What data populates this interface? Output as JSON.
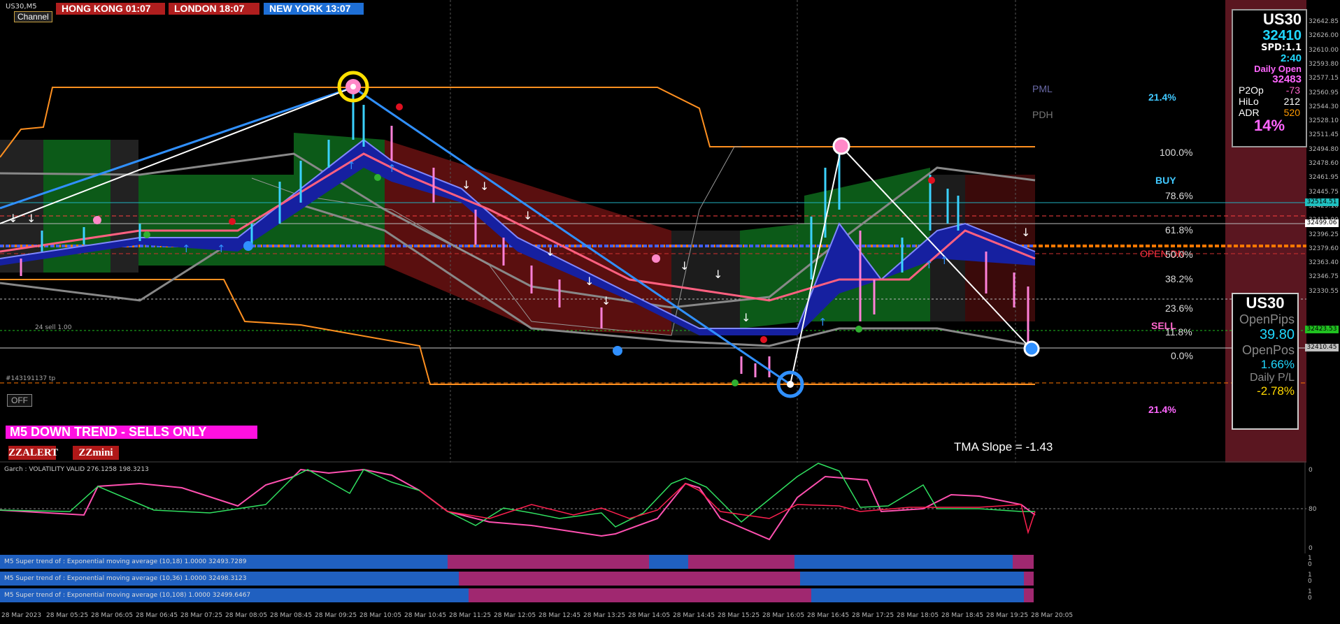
{
  "symbol": "US30,M5",
  "channel_button": "Channel",
  "sessions": [
    {
      "label": "HONG KONG 01:07",
      "color": "#b01e1e"
    },
    {
      "label": "LONDON  18:07",
      "color": "#b01e1e"
    },
    {
      "label": "NEW YORK  13:07",
      "color": "#1e6fd6"
    }
  ],
  "labels": {
    "pml": "PML",
    "pdh": "PDH",
    "buy": "BUY",
    "sell": "SELL",
    "open_dn": "OPEN  DN",
    "pct_top": "21.4%",
    "pct_bottom": "21.4%",
    "trade_label": "24 sell 1.00",
    "ticket": "#143191137 tp",
    "off_button": "OFF",
    "trend_banner": "M5  DOWN TREND - SELLS ONLY",
    "zzalert": "ZZALERT",
    "zzmini": "ZZmini",
    "tma_slope": "TMA Slope = -1.43"
  },
  "fib_levels": [
    "100.0%",
    "78.6%",
    "61.8%",
    "50.0%",
    "38.2%",
    "23.6%",
    "11.8%",
    "0.0%"
  ],
  "info_panel": {
    "symbol": "US30",
    "price": "32410",
    "spread": "SPD:1.1",
    "timer": "2:40",
    "daily_open_label": "Daily Open",
    "daily_open": "32483",
    "rows": [
      {
        "label": "P2Op",
        "value": "-73",
        "color": "#ff66cc"
      },
      {
        "label": "HiLo",
        "value": "212",
        "color": "#ffffff"
      },
      {
        "label": "ADR",
        "value": "520",
        "color": "#ff9900"
      }
    ],
    "adr_pct": "14%"
  },
  "pos_panel": {
    "symbol": "US30",
    "open_pips_label": "OpenPips",
    "open_pips": "39.80",
    "open_pos_label": "OpenPos",
    "open_pos": "1.66%",
    "daily_pl_label": "Daily P/L",
    "daily_pl": "-2.78%"
  },
  "price_axis": [
    "32642.85",
    "32626.00",
    "32610.00",
    "32593.80",
    "32577.15",
    "32560.95",
    "32544.30",
    "32528.10",
    "32511.45",
    "32494.80",
    "32478.60",
    "32461.95",
    "32445.75",
    "32429.10",
    "32412.90",
    "32396.25",
    "32379.60",
    "32363.40",
    "32346.75",
    "32330.55"
  ],
  "price_tags": [
    {
      "value": "32514.51",
      "color": "#20c0c0"
    },
    {
      "value": "32499.06",
      "color": "#ffffff"
    },
    {
      "value": "32423.53",
      "color": "#20c020"
    },
    {
      "value": "32410.45",
      "color": "#c0c0c0"
    }
  ],
  "garch": {
    "label": "Garch : VOLATILITY VALID 276.1258 198.3213",
    "axis": [
      "0",
      "80",
      "0"
    ]
  },
  "supertrend_rows": [
    {
      "label": "M5  Super trend of : Exponential moving average (10,18)  1.0000 32493.7289",
      "axis": [
        "1",
        "0"
      ]
    },
    {
      "label": "M5  Super trend of : Exponential moving average (10,36)  1.0000 32498.3123",
      "axis": [
        "1",
        "0"
      ]
    },
    {
      "label": "M5  Super trend of : Exponential moving average (10,108)  1.0000 32499.6467",
      "axis": [
        "1",
        "0"
      ]
    }
  ],
  "time_axis": [
    "28 Mar 2023",
    "28 Mar 05:25",
    "28 Mar 06:05",
    "28 Mar 06:45",
    "28 Mar 07:25",
    "28 Mar 08:05",
    "28 Mar 08:45",
    "28 Mar 09:25",
    "28 Mar 10:05",
    "28 Mar 10:45",
    "28 Mar 11:25",
    "28 Mar 12:05",
    "28 Mar 12:45",
    "28 Mar 13:25",
    "28 Mar 14:05",
    "28 Mar 14:45",
    "28 Mar 15:25",
    "28 Mar 16:05",
    "28 Mar 16:45",
    "28 Mar 17:25",
    "28 Mar 18:05",
    "28 Mar 18:45",
    "28 Mar 19:25",
    "28 Mar 20:05"
  ]
}
